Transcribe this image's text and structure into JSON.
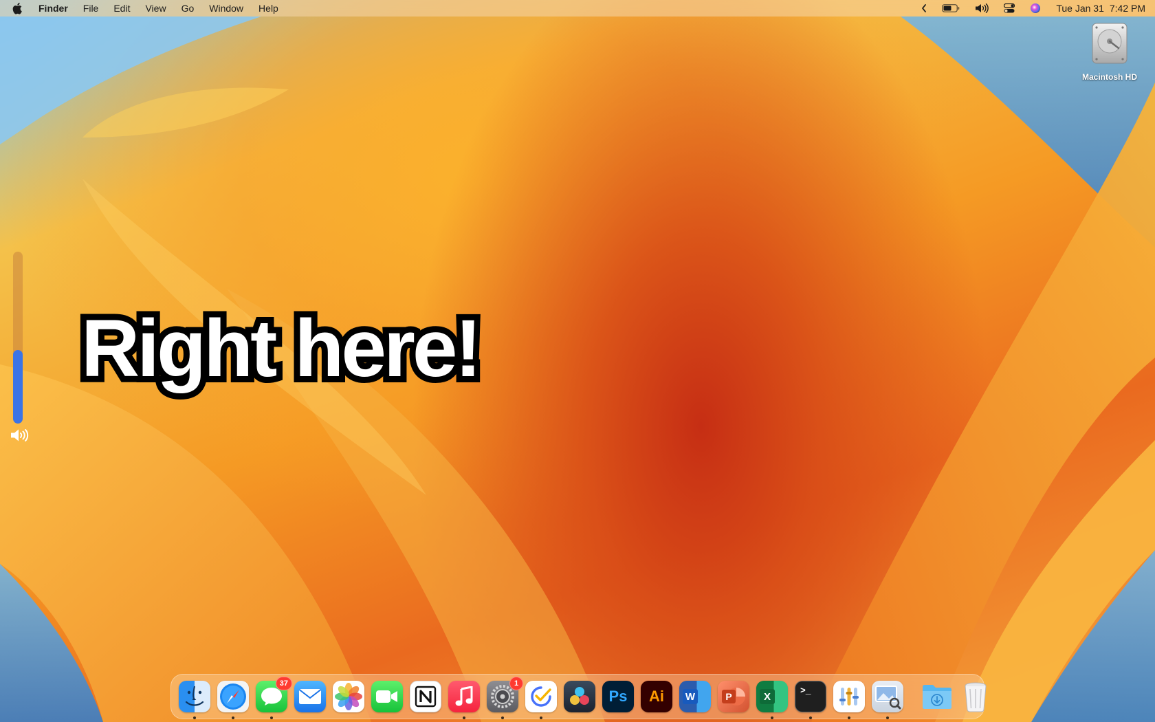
{
  "menubar": {
    "apple_icon": "apple-logo-icon",
    "app_name": "Finder",
    "menus": [
      "File",
      "Edit",
      "View",
      "Go",
      "Window",
      "Help"
    ],
    "status_icons": [
      "chevron-left-icon",
      "battery-icon",
      "volume-icon",
      "control-center-icon",
      "siri-icon"
    ],
    "clock": {
      "date": "Tue Jan 31",
      "time": "7:42 PM"
    }
  },
  "desktop": {
    "drive": {
      "label": "Macintosh HD",
      "icon": "hard-drive-icon"
    }
  },
  "volume_hud": {
    "icon": "speaker-icon",
    "level": 0.43
  },
  "caption": {
    "text": "Right here!"
  },
  "dock": {
    "apps": [
      {
        "name": "Finder",
        "icon": "finder-icon",
        "running": true,
        "badge": ""
      },
      {
        "name": "Safari",
        "icon": "safari-icon",
        "running": true,
        "badge": ""
      },
      {
        "name": "Messages",
        "icon": "messages-icon",
        "running": true,
        "badge": "37"
      },
      {
        "name": "Mail",
        "icon": "mail-icon",
        "running": false,
        "badge": ""
      },
      {
        "name": "Photos",
        "icon": "photos-icon",
        "running": false,
        "badge": ""
      },
      {
        "name": "FaceTime",
        "icon": "facetime-icon",
        "running": false,
        "badge": ""
      },
      {
        "name": "Notion",
        "icon": "notion-icon",
        "running": false,
        "badge": ""
      },
      {
        "name": "Music",
        "icon": "music-icon",
        "running": true,
        "badge": ""
      },
      {
        "name": "System Settings",
        "icon": "system-settings-icon",
        "running": true,
        "badge": "1"
      },
      {
        "name": "TickTick",
        "icon": "ticktick-icon",
        "running": true,
        "badge": ""
      },
      {
        "name": "DaVinci Resolve",
        "icon": "davinci-resolve-icon",
        "running": false,
        "badge": ""
      },
      {
        "name": "Photoshop",
        "icon": "photoshop-icon",
        "running": false,
        "badge": "",
        "glyph": "Ps"
      },
      {
        "name": "Illustrator",
        "icon": "illustrator-icon",
        "running": false,
        "badge": "",
        "glyph": "Ai"
      },
      {
        "name": "Word",
        "icon": "word-icon",
        "running": false,
        "badge": "",
        "glyph": "W"
      },
      {
        "name": "PowerPoint",
        "icon": "powerpoint-icon",
        "running": false,
        "badge": "",
        "glyph": "P"
      },
      {
        "name": "Excel",
        "icon": "excel-icon",
        "running": true,
        "badge": "",
        "glyph": "X"
      },
      {
        "name": "Terminal",
        "icon": "terminal-icon",
        "running": true,
        "badge": "",
        "glyph": ">_"
      },
      {
        "name": "Instruments",
        "icon": "instruments-icon",
        "running": true,
        "badge": ""
      },
      {
        "name": "Preview",
        "icon": "preview-icon",
        "running": true,
        "badge": ""
      }
    ],
    "stacks": [
      {
        "name": "Downloads",
        "icon": "downloads-folder-icon"
      },
      {
        "name": "Trash",
        "icon": "trash-icon"
      }
    ]
  },
  "colors": {
    "accent_blue": "#3b74e6",
    "badge_red": "#ff3b30",
    "wallpaper_orange": "#f59a24",
    "wallpaper_red": "#c62e14"
  }
}
